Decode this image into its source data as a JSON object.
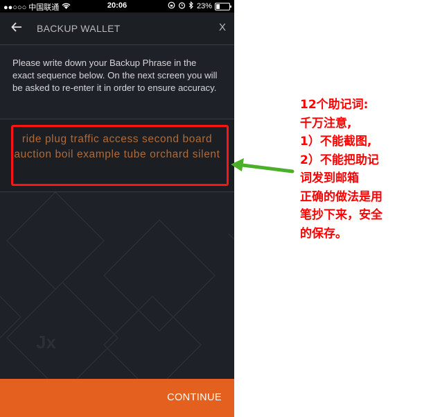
{
  "status_bar": {
    "carrier": "●●○○○ 中国联通",
    "time": "20:06",
    "battery": "23%"
  },
  "header": {
    "title": "BACKUP WALLET",
    "close_label": "X"
  },
  "instructions": "Please write down your Backup Phrase in the exact sequence below. On the next screen you will be asked to re-enter it in order to ensure accuracy.",
  "backup_phrase": "ride plug traffic access second board auction boil example tube orchard silent",
  "logo": "Jx",
  "continue_label": "CONTINUE",
  "annotation": {
    "lines": [
      "12个助记词:",
      "千万注意,",
      "1）不能截图,",
      "2）不能把助记",
      "词发到邮箱",
      "正确的做法是用",
      "笔抄下来，安全",
      "的保存。"
    ]
  },
  "colors": {
    "accent": "#e4601f",
    "phrase": "#b06b38",
    "annotation": "#ff0000"
  },
  "icons": {
    "back": "arrow-left-icon",
    "wifi": "wifi-icon",
    "alarm": "alarm-icon",
    "bluetooth": "bluetooth-icon",
    "battery": "battery-icon"
  }
}
